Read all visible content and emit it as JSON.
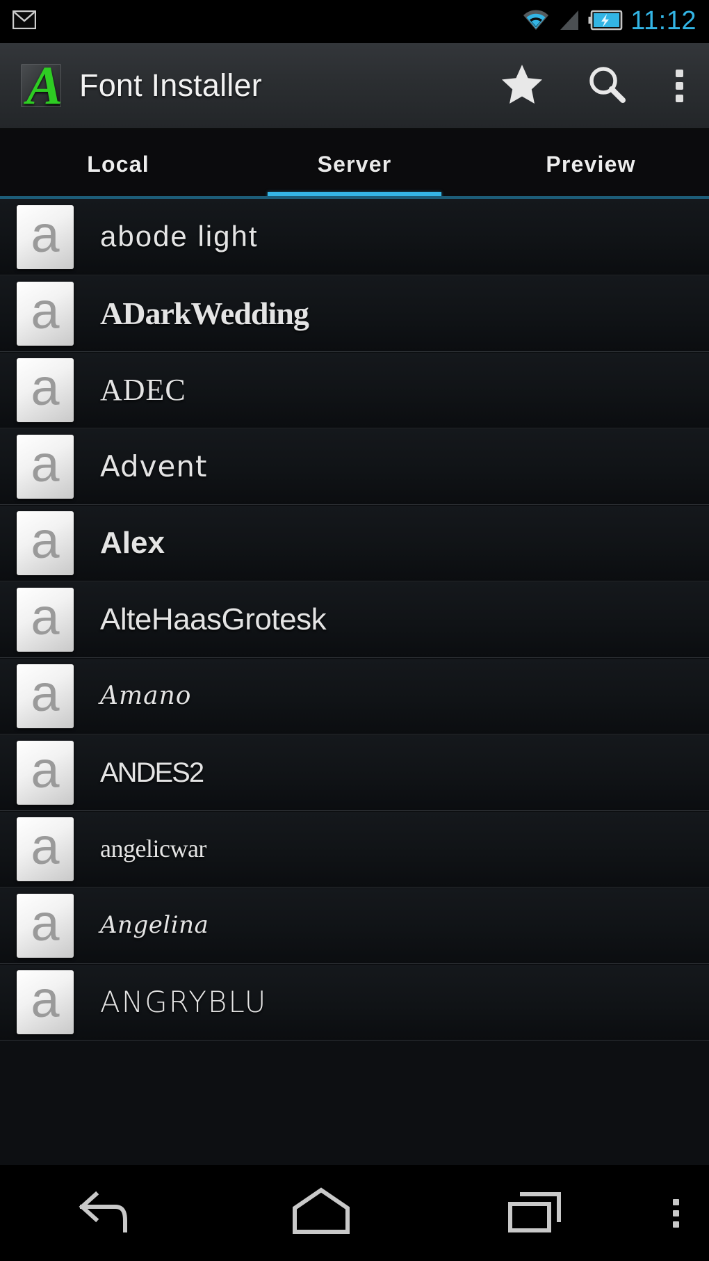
{
  "status_bar": {
    "notification_icon": "gmail-icon",
    "wifi_icon": "wifi-icon",
    "signal_icon": "cellular-signal-icon",
    "battery_icon": "battery-charging-icon",
    "time": "11:12",
    "time_color": "#33b5e5"
  },
  "action_bar": {
    "logo_icon": "font-installer-logo-icon",
    "logo_letter": "A",
    "title": "Font Installer",
    "actions": [
      {
        "name": "favorites-button",
        "icon": "star-icon"
      },
      {
        "name": "search-button",
        "icon": "search-icon"
      },
      {
        "name": "overflow-menu-button",
        "icon": "overflow-menu-icon"
      }
    ]
  },
  "tabs": {
    "active_index": 1,
    "accent_color": "#35b6e6",
    "items": [
      {
        "label": "Local"
      },
      {
        "label": "Server"
      },
      {
        "label": "Preview"
      }
    ]
  },
  "font_list": {
    "thumbnail_glyph": "a",
    "items": [
      {
        "name": "abode light",
        "style": "f-thin"
      },
      {
        "name": "ADarkWedding",
        "style": "f-gothic"
      },
      {
        "name": "ADEC",
        "style": "f-serifcaps"
      },
      {
        "name": "Advent",
        "style": "f-sansthin"
      },
      {
        "name": "Alex",
        "style": "f-bold"
      },
      {
        "name": "AlteHaasGrotesk",
        "style": "f-grotesk"
      },
      {
        "name": "Amano",
        "style": "f-script"
      },
      {
        "name": "ANDES2",
        "style": "f-display"
      },
      {
        "name": "angelicwar",
        "style": "f-smallserif"
      },
      {
        "name": "Angelina",
        "style": "f-italscr"
      },
      {
        "name": "ANGRYBLU",
        "style": "f-rough"
      }
    ]
  },
  "nav_bar": {
    "items": [
      {
        "name": "back-button",
        "icon": "back-arrow-icon"
      },
      {
        "name": "home-button",
        "icon": "home-icon"
      },
      {
        "name": "recents-button",
        "icon": "recents-icon"
      }
    ],
    "menu": {
      "name": "nav-overflow-button",
      "icon": "overflow-menu-icon"
    }
  }
}
